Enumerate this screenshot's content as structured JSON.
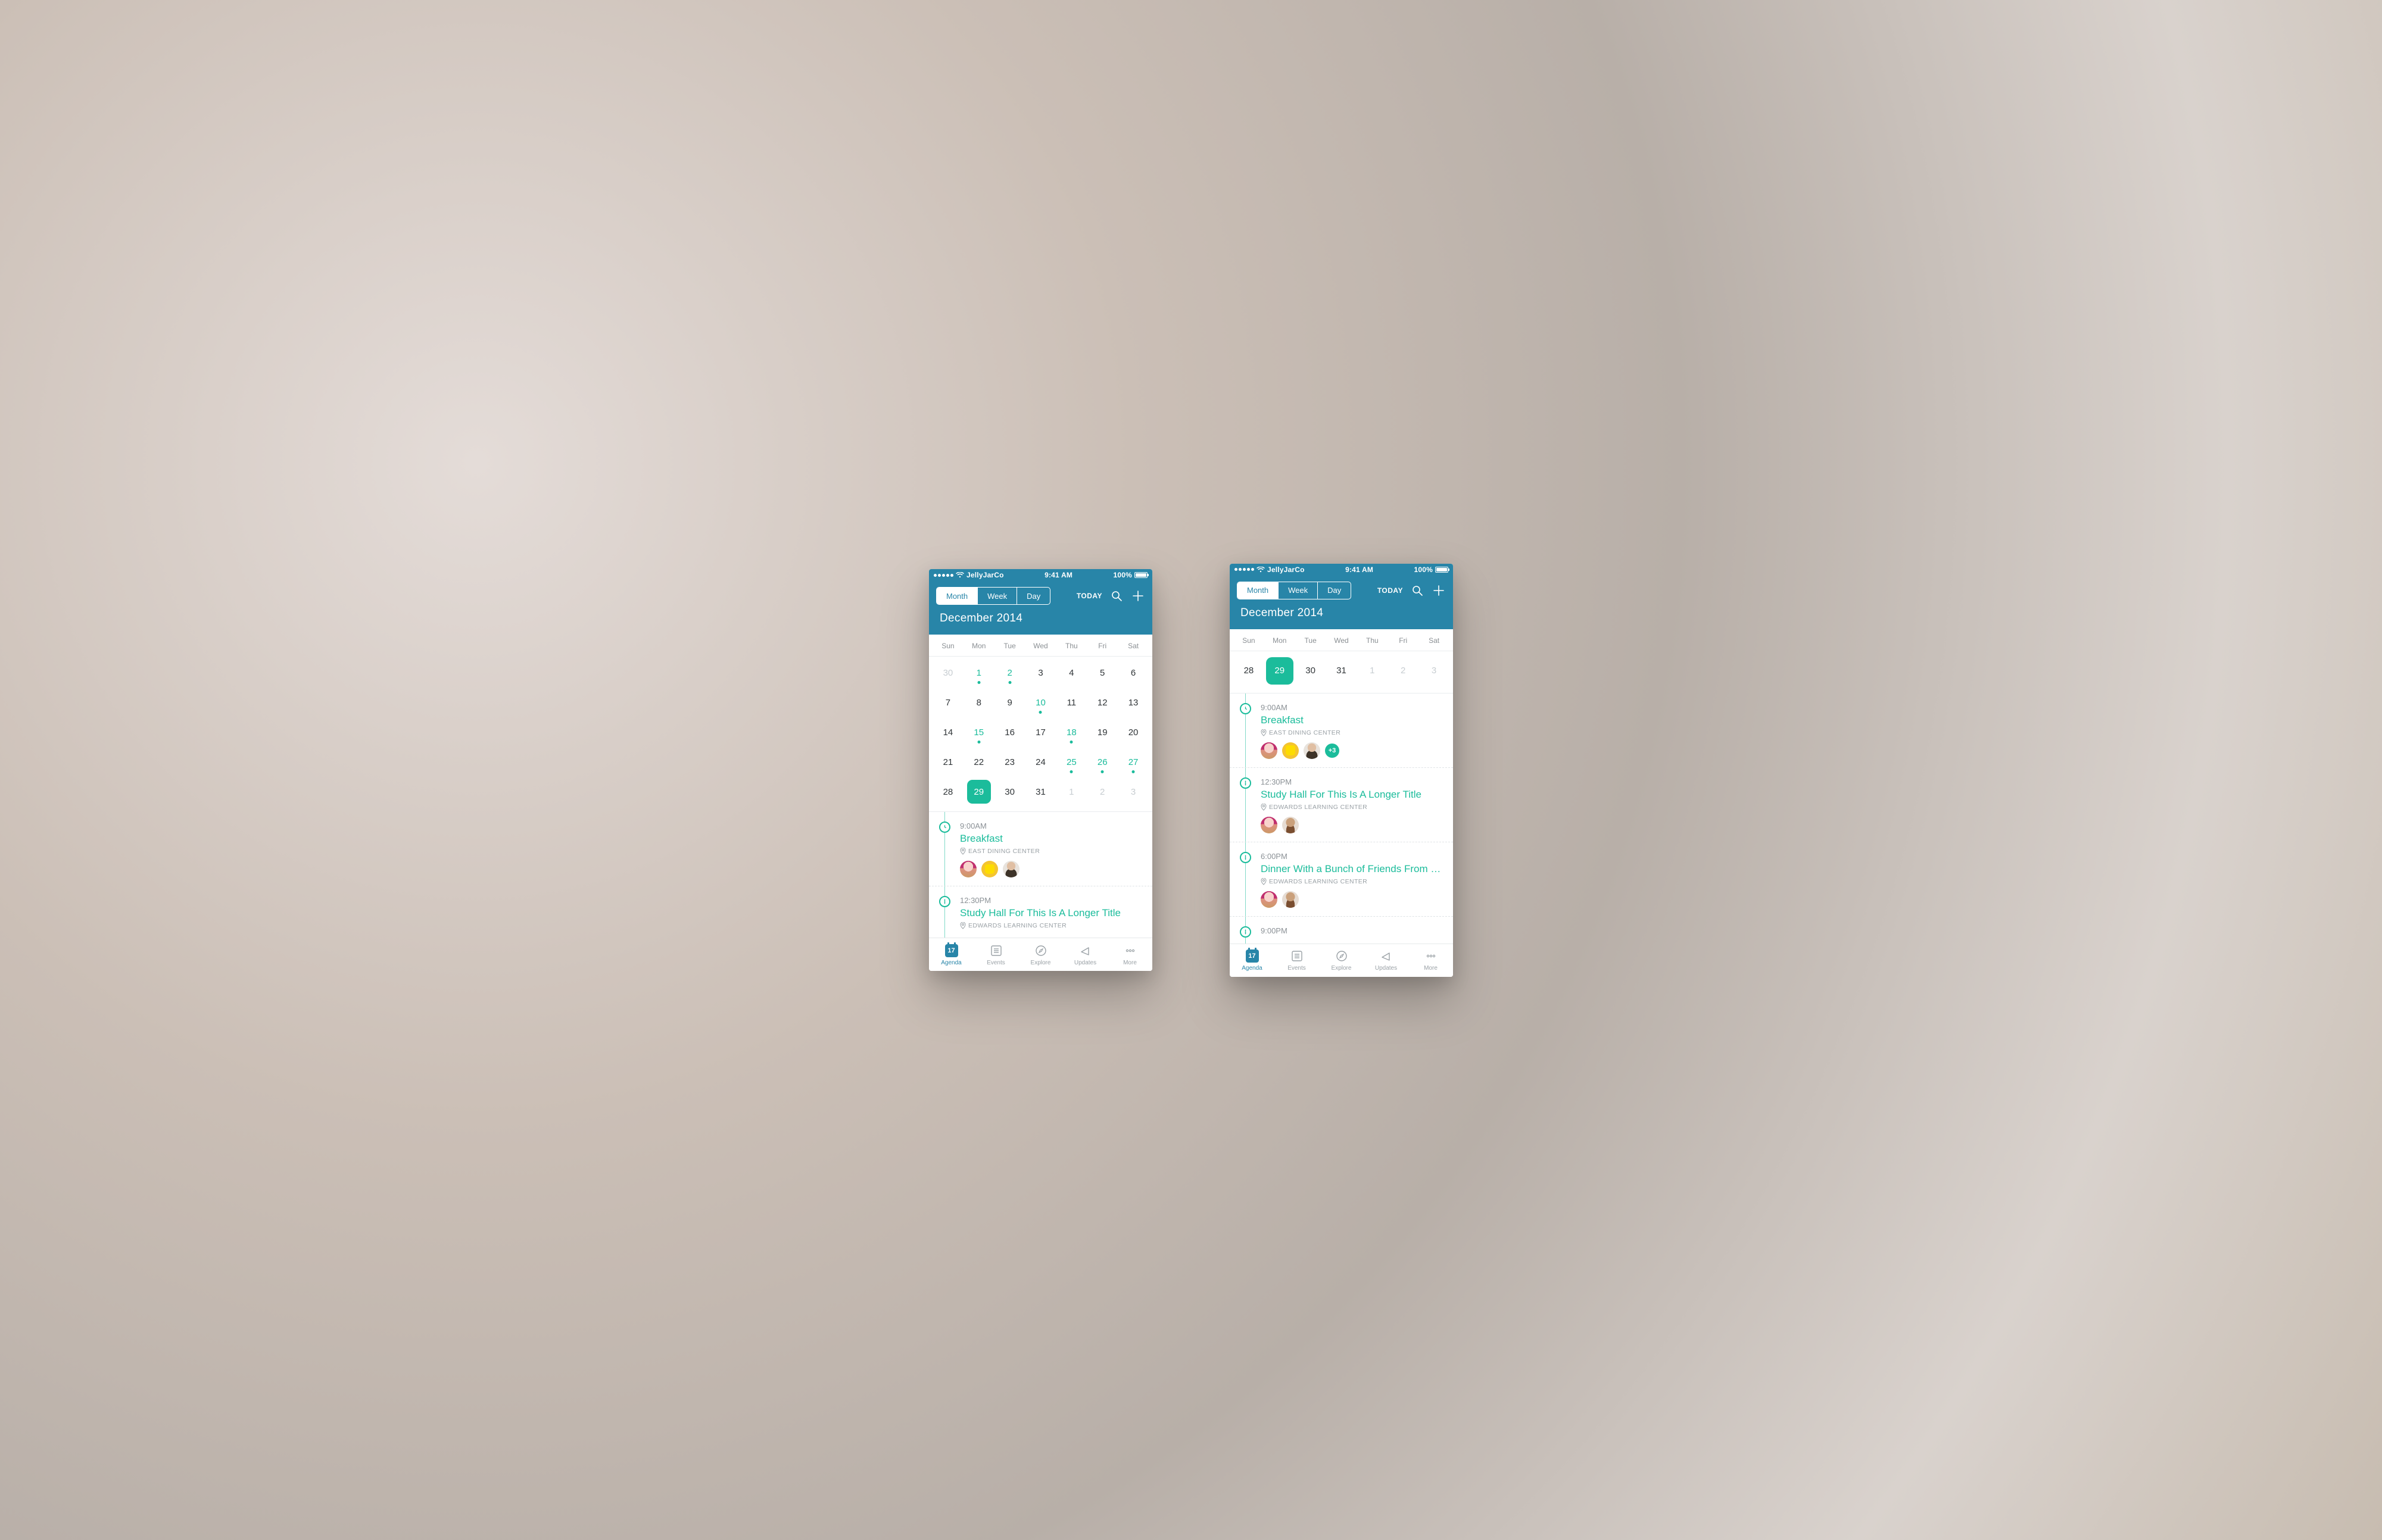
{
  "status": {
    "carrier": "JellyJarCo",
    "time": "9:41 AM",
    "battery": "100%"
  },
  "header": {
    "segments": {
      "month": "Month",
      "week": "Week",
      "day": "Day"
    },
    "today": "TODAY",
    "title": "December 2014"
  },
  "dow": [
    "Sun",
    "Mon",
    "Tue",
    "Wed",
    "Thu",
    "Fri",
    "Sat"
  ],
  "monthGrid": [
    [
      {
        "n": "30",
        "outside": true
      },
      {
        "n": "1",
        "accent": true,
        "dot": true
      },
      {
        "n": "2",
        "accent": true,
        "dot": true
      },
      {
        "n": "3"
      },
      {
        "n": "4"
      },
      {
        "n": "5"
      },
      {
        "n": "6"
      }
    ],
    [
      {
        "n": "7"
      },
      {
        "n": "8"
      },
      {
        "n": "9"
      },
      {
        "n": "10",
        "accent": true,
        "dot": true
      },
      {
        "n": "11"
      },
      {
        "n": "12"
      },
      {
        "n": "13"
      }
    ],
    [
      {
        "n": "14"
      },
      {
        "n": "15",
        "accent": true,
        "dot": true
      },
      {
        "n": "16"
      },
      {
        "n": "17"
      },
      {
        "n": "18",
        "accent": true,
        "dot": true
      },
      {
        "n": "19"
      },
      {
        "n": "20"
      }
    ],
    [
      {
        "n": "21"
      },
      {
        "n": "22"
      },
      {
        "n": "23"
      },
      {
        "n": "24"
      },
      {
        "n": "25",
        "accent": true,
        "dot": true
      },
      {
        "n": "26",
        "accent": true,
        "dot": true
      },
      {
        "n": "27",
        "accent": true,
        "dot": true
      }
    ],
    [
      {
        "n": "28"
      },
      {
        "n": "29",
        "selected": true
      },
      {
        "n": "30"
      },
      {
        "n": "31"
      },
      {
        "n": "1",
        "outside": true
      },
      {
        "n": "2",
        "outside": true
      },
      {
        "n": "3",
        "outside": true
      }
    ]
  ],
  "weekGrid": [
    {
      "n": "28"
    },
    {
      "n": "29",
      "selected": true
    },
    {
      "n": "30"
    },
    {
      "n": "31"
    },
    {
      "n": "1",
      "outside": true
    },
    {
      "n": "2",
      "outside": true
    },
    {
      "n": "3",
      "outside": true
    }
  ],
  "agendaLeft": [
    {
      "time": "9:00AM",
      "title": "Breakfast",
      "location": "EAST DINING CENTER",
      "icon": "clock",
      "attendees": [
        "a1",
        "a2",
        "a3"
      ]
    },
    {
      "time": "12:30PM",
      "title": "Study Hall For This Is A Longer Title",
      "location": "EDWARDS LEARNING CENTER",
      "icon": "info",
      "attendees": []
    }
  ],
  "agendaRight": [
    {
      "time": "9:00AM",
      "title": "Breakfast",
      "location": "EAST DINING CENTER",
      "icon": "clock",
      "attendees": [
        "a1",
        "a2",
        "a3"
      ],
      "more": "+3"
    },
    {
      "time": "12:30PM",
      "title": "Study Hall For This Is A Longer Title",
      "location": "EDWARDS LEARNING CENTER",
      "icon": "info",
      "attendees": [
        "a1",
        "a4"
      ]
    },
    {
      "time": "6:00PM",
      "title": "Dinner With a Bunch of Friends From My D....",
      "location": "EDWARDS LEARNING CENTER",
      "icon": "info",
      "attendees": [
        "a1",
        "a4"
      ]
    },
    {
      "time": "9:00PM",
      "title": "",
      "location": "",
      "icon": "info",
      "attendees": []
    }
  ],
  "tabs": {
    "agenda": {
      "label": "Agenda",
      "badge": "17"
    },
    "events": {
      "label": "Events"
    },
    "explore": {
      "label": "Explore"
    },
    "updates": {
      "label": "Updates"
    },
    "more": {
      "label": "More"
    }
  }
}
